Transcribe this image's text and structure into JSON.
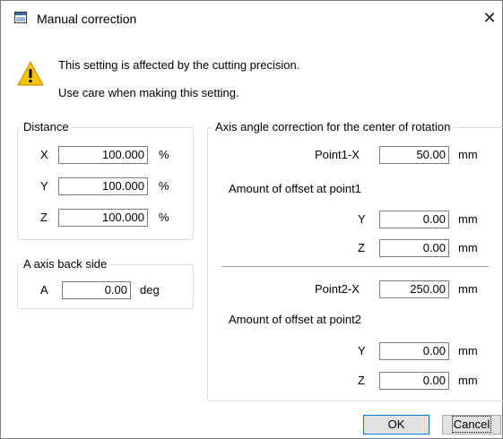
{
  "window": {
    "title": "Manual correction",
    "close_glyph": "✕"
  },
  "warning": {
    "icon": "warning-triangle-icon",
    "line1": "This setting is affected by the cutting precision.",
    "line2": "Use care when making this setting."
  },
  "distance": {
    "legend": "Distance",
    "rows": [
      {
        "label": "X",
        "value": "100.000",
        "unit": "%"
      },
      {
        "label": "Y",
        "value": "100.000",
        "unit": "%"
      },
      {
        "label": "Z",
        "value": "100.000",
        "unit": "%"
      }
    ]
  },
  "a_axis": {
    "legend": "A axis back side",
    "label": "A",
    "value": "0.00",
    "unit": "deg"
  },
  "axis_angle": {
    "legend": "Axis angle correction for the center of rotation",
    "point1_x": {
      "label": "Point1-X",
      "value": "50.00",
      "unit": "mm"
    },
    "offset1_label": "Amount of offset at point1",
    "offset1_y": {
      "label": "Y",
      "value": "0.00",
      "unit": "mm"
    },
    "offset1_z": {
      "label": "Z",
      "value": "0.00",
      "unit": "mm"
    },
    "point2_x": {
      "label": "Point2-X",
      "value": "250.00",
      "unit": "mm"
    },
    "offset2_label": "Amount of offset at point2",
    "offset2_y": {
      "label": "Y",
      "value": "0.00",
      "unit": "mm"
    },
    "offset2_z": {
      "label": "Z",
      "value": "0.00",
      "unit": "mm"
    }
  },
  "buttons": {
    "ok": "OK",
    "cancel": "Cancel"
  }
}
